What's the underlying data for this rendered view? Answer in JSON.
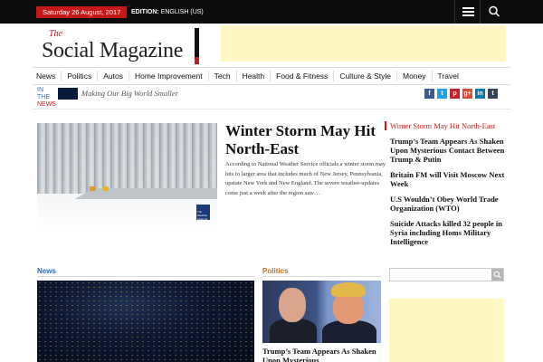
{
  "topbar": {
    "date": "Saturday 26 August, 2017",
    "edition_label": "EDITION:",
    "edition_value": "ENGLISH (US)",
    "menu_icon": "hamburger-menu-icon",
    "search_icon": "search-icon"
  },
  "logo": {
    "the": "The",
    "name": "Social Magazine"
  },
  "nav": [
    "News",
    "Politics",
    "Autos",
    "Home Improvement",
    "Tech",
    "Health",
    "Food & Fitness",
    "Culture & Style",
    "Money",
    "Travel"
  ],
  "ticker": {
    "label_line1": "IN",
    "label_line2": "THE",
    "label_line3": "NEWS",
    "text": "Making Our Big World Smaller"
  },
  "social": [
    {
      "icon": "facebook-icon",
      "glyph": "f",
      "color": "#3b5998"
    },
    {
      "icon": "twitter-icon",
      "glyph": "t",
      "color": "#1da1f2"
    },
    {
      "icon": "pinterest-icon",
      "glyph": "p",
      "color": "#cb2027"
    },
    {
      "icon": "google-plus-icon",
      "glyph": "g+",
      "color": "#dd4b39"
    },
    {
      "icon": "linkedin-icon",
      "glyph": "in",
      "color": "#0077b5"
    },
    {
      "icon": "tumblr-icon",
      "glyph": "t",
      "color": "#35465c"
    }
  ],
  "featured": {
    "title": "Winter Storm May Hit North-East",
    "body": "According to National Weather Service officials a winter storm may hits to larger area that includes much of New Jersey, Pennsylvania, upstate New York and New England. The severe weather-updates come just a week after the region saw…",
    "image_logo": "The Weather Channel"
  },
  "side_headlines": [
    "Winter Storm May Hit North-East",
    "Trump’s Team Appears As Shaken Upon Mysterious Contact Between Trump & Putin",
    "Britain FM will Visit Moscow Next Week",
    "U.S Wouldn’t Obey World Trade Organization (WTO)",
    "Suicide Attacks killed 32 people in Syria including Homs Military Intelligence"
  ],
  "sections": {
    "news": {
      "label": "News",
      "color": "#2a6ebb"
    },
    "politics": {
      "label": "Politics",
      "color": "#c0772a",
      "headline": "Trump’s Team Appears As Shaken Upon Mysterious"
    }
  },
  "search": {
    "placeholder": ""
  }
}
